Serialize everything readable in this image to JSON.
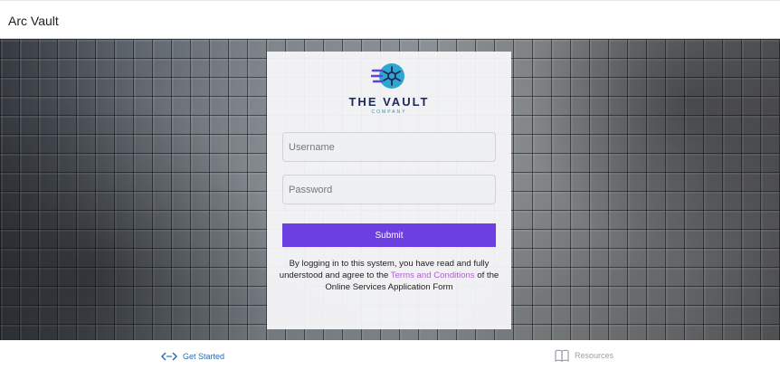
{
  "header": {
    "title": "Arc Vault"
  },
  "logo": {
    "name": "THE VAULT",
    "subtitle": "COMPANY"
  },
  "form": {
    "username_placeholder": "Username",
    "password_placeholder": "Password",
    "submit_label": "Submit"
  },
  "disclaimer": {
    "prefix": "By logging in to this system, you have read and fully understood and agree to the ",
    "link_text": "Terms and Conditions",
    "suffix": " of the Online Services Application Form"
  },
  "footer": {
    "get_started": {
      "label": "Get Started",
      "icon": "code-arrows-icon"
    },
    "resources": {
      "label": "Resources",
      "icon": "book-icon"
    }
  },
  "colors": {
    "accent": "#6c3fe0",
    "link": "#b05fd0",
    "logo_text": "#1f2757",
    "logo_circle": "#2fa6d2",
    "footer_link": "#2b6cb0"
  }
}
